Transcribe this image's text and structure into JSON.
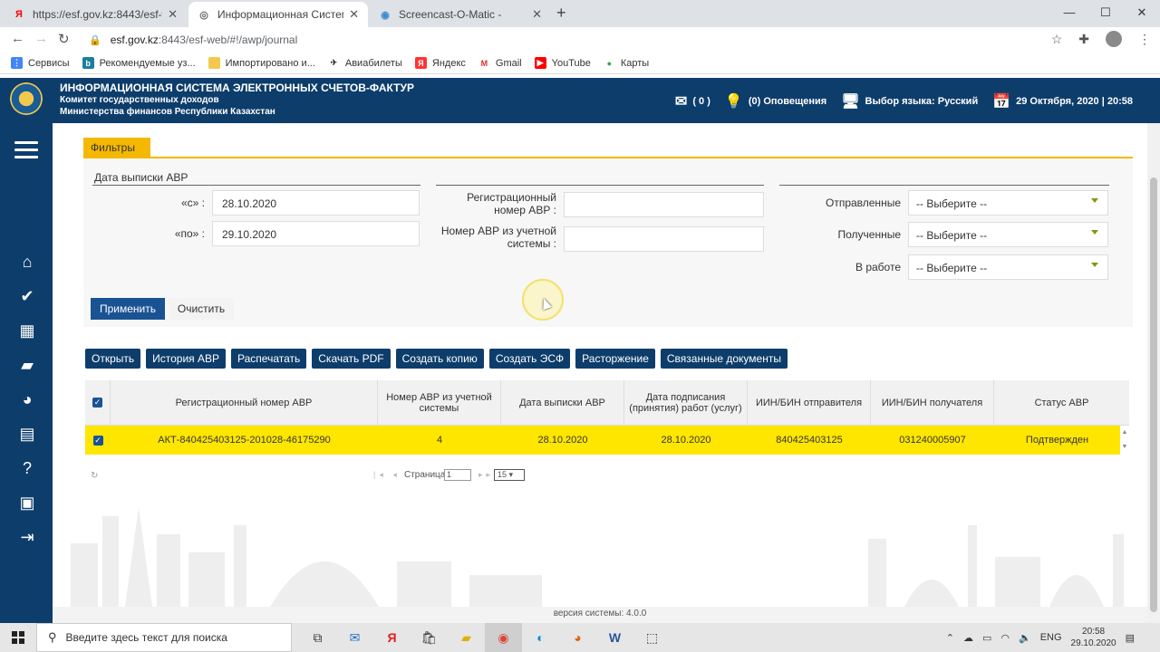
{
  "browser": {
    "tabs": [
      {
        "title": "https://esf.gov.kz:8443/esf-web/",
        "fav": "Я",
        "fav_color": "#ff0000"
      },
      {
        "title": "Информационная Система Эле",
        "fav": "◎",
        "fav_color": "#666666"
      },
      {
        "title": "Screencast-O-Matic -",
        "fav": "◉",
        "fav_color": "#3b8bd4"
      }
    ],
    "url_host": "esf.gov.kz",
    "url_path": ":8443/esf-web/#!/awp/journal",
    "bookmarks": [
      "Сервисы",
      "Рекомендуемые уз...",
      "Импортировано и...",
      "Авиабилеты",
      "Яндекс",
      "Gmail",
      "YouTube",
      "Карты"
    ]
  },
  "header": {
    "title": "ИНФОРМАЦИОННАЯ СИСТЕМА ЭЛЕКТРОННЫХ СЧЕТОВ-ФАКТУР",
    "subtitle1": "Комитет государственных доходов",
    "subtitle2": "Министерства финансов Республики Казахстан",
    "messages": "( 0 )",
    "notifications": "(0) Оповещения",
    "language": "Выбор языка: Русский",
    "datetime": "29 Октября, 2020 | 20:58"
  },
  "filters": {
    "tab_label": "Фильтры",
    "date_section": "Дата выписки АВР",
    "from_label": "«с» :",
    "from_value": "28.10.2020",
    "to_label": "«по» :",
    "to_value": "29.10.2020",
    "reg_number_label": "Регистрационный номер АВР :",
    "acct_number_label": "Номер АВР из учетной системы :",
    "sent_label": "Отправленные",
    "received_label": "Полученные",
    "in_work_label": "В работе",
    "select_placeholder": "-- Выберите --",
    "apply": "Применить",
    "clear": "Очистить"
  },
  "toolbar": [
    "Открыть",
    "История АВР",
    "Распечатать",
    "Скачать PDF",
    "Создать копию",
    "Создать ЭСФ",
    "Расторжение",
    "Связанные документы"
  ],
  "table": {
    "columns": [
      "Регистрационный номер АВР",
      "Номер АВР из учетной системы",
      "Дата выписки АВР",
      "Дата подписания (принятия) работ (услуг)",
      "ИИН/БИН отправителя",
      "ИИН/БИН получателя",
      "Статус АВР"
    ],
    "rows": [
      [
        "АКТ-840425403125-201028-46175290",
        "4",
        "28.10.2020",
        "28.10.2020",
        "840425403125",
        "031240005907",
        "Подтвержден"
      ]
    ]
  },
  "pager": {
    "label": "Страница",
    "page": "1",
    "page_size": "15"
  },
  "footer": {
    "version": "версия системы: 4.0.0"
  },
  "taskbar": {
    "search_placeholder": "Введите здесь текст для поиска",
    "lang": "ENG",
    "time": "20:58",
    "date": "29.10.2020"
  }
}
